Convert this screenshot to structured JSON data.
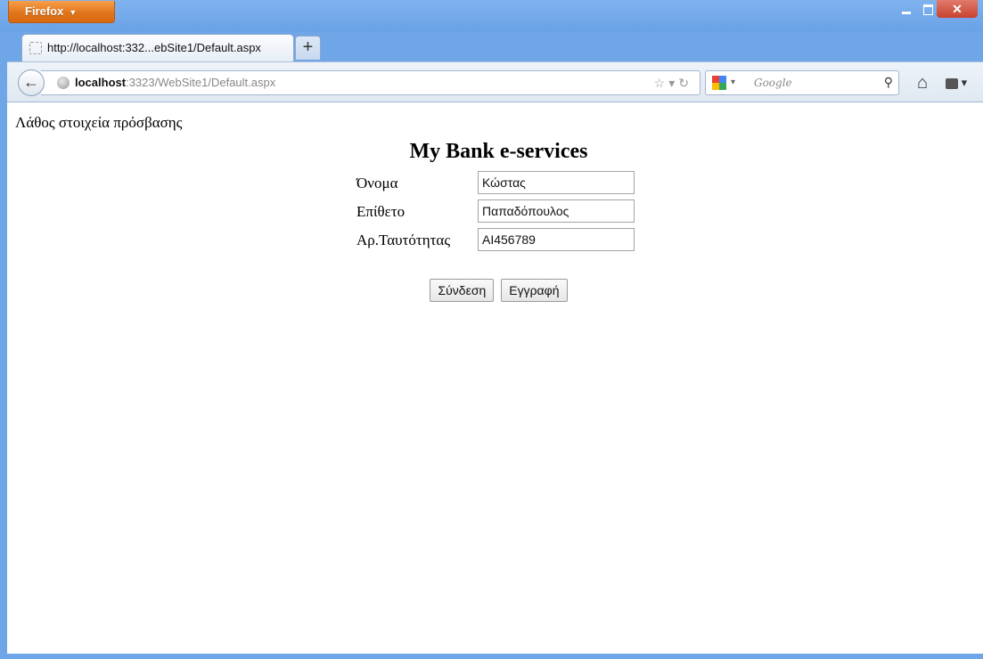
{
  "browser": {
    "app_button": "Firefox",
    "tab_title": "http://localhost:332...ebSite1/Default.aspx",
    "new_tab": "+",
    "url_host": "localhost",
    "url_rest": ":3323/WebSite1/Default.aspx",
    "search_placeholder": "Google"
  },
  "page": {
    "error_message": "Λάθος στοιχεία πρόσβασης",
    "title": "My Bank e-services",
    "fields": [
      {
        "label": "Όνομα",
        "value": "Κώστας"
      },
      {
        "label": "Επίθετο",
        "value": "Παπαδόπουλος"
      },
      {
        "label": "Αρ.Ταυτότητας",
        "value": "ΑΙ456789"
      }
    ],
    "buttons": {
      "login": "Σύνδεση",
      "register": "Εγγραφή"
    }
  }
}
